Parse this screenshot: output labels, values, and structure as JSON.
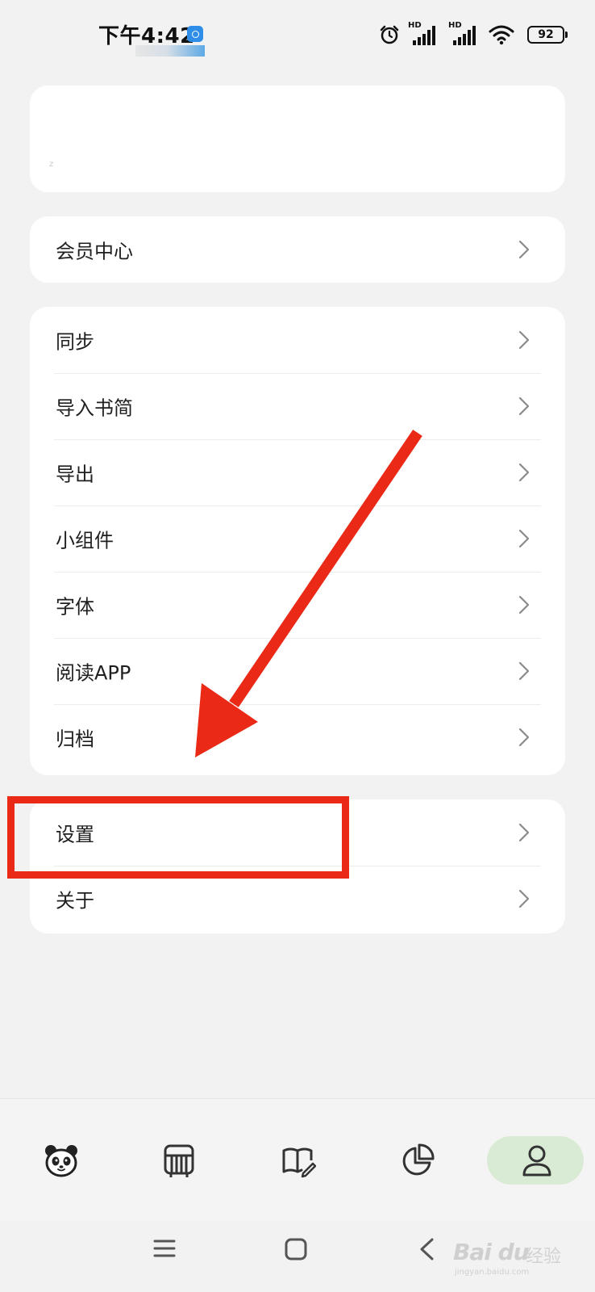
{
  "status_bar": {
    "time": "下午4:42",
    "hd_label": "HD",
    "battery": "92"
  },
  "menu": {
    "member_center": "会员中心",
    "sync": "同步",
    "import_bookmarks": "导入书简",
    "export": "导出",
    "widgets": "小组件",
    "fonts": "字体",
    "reading_app": "阅读APP",
    "archive": "归档",
    "settings": "设置",
    "about": "关于"
  },
  "tab_bar": {
    "tabs": [
      {
        "icon": "panda-icon"
      },
      {
        "icon": "bookshelf-icon"
      },
      {
        "icon": "book-edit-icon"
      },
      {
        "icon": "pie-chart-icon"
      },
      {
        "icon": "profile-icon",
        "active": true
      }
    ],
    "active_color": "#d9ebd4"
  },
  "annotations": {
    "highlight_color": "#ea2a17"
  },
  "watermark": {
    "brand": "Bai du",
    "sub": "经验",
    "url": "jingyan.baidu.com"
  }
}
